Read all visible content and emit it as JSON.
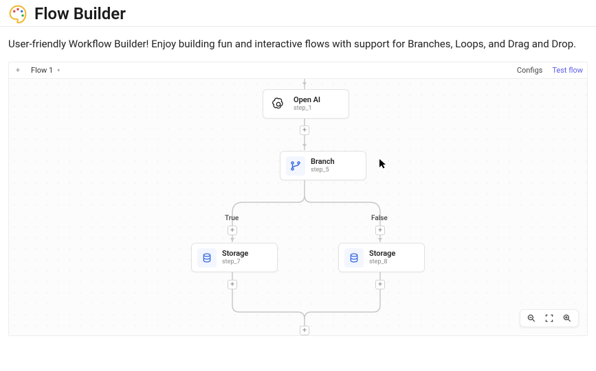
{
  "header": {
    "title": "Flow Builder"
  },
  "tagline": "User-friendly Workflow Builder! Enjoy building fun and interactive flows with support for Branches, Loops, and Drag and Drop.",
  "toolbar": {
    "tab_label": "Flow 1",
    "configs_label": "Configs",
    "test_label": "Test flow"
  },
  "nodes": {
    "openai": {
      "title": "Open AI",
      "subtitle": "step_1"
    },
    "branch": {
      "title": "Branch",
      "subtitle": "step_5"
    },
    "storage_left": {
      "title": "Storage",
      "subtitle": "step_7"
    },
    "storage_right": {
      "title": "Storage",
      "subtitle": "step_8"
    }
  },
  "branch_labels": {
    "true": "True",
    "false": "False"
  }
}
